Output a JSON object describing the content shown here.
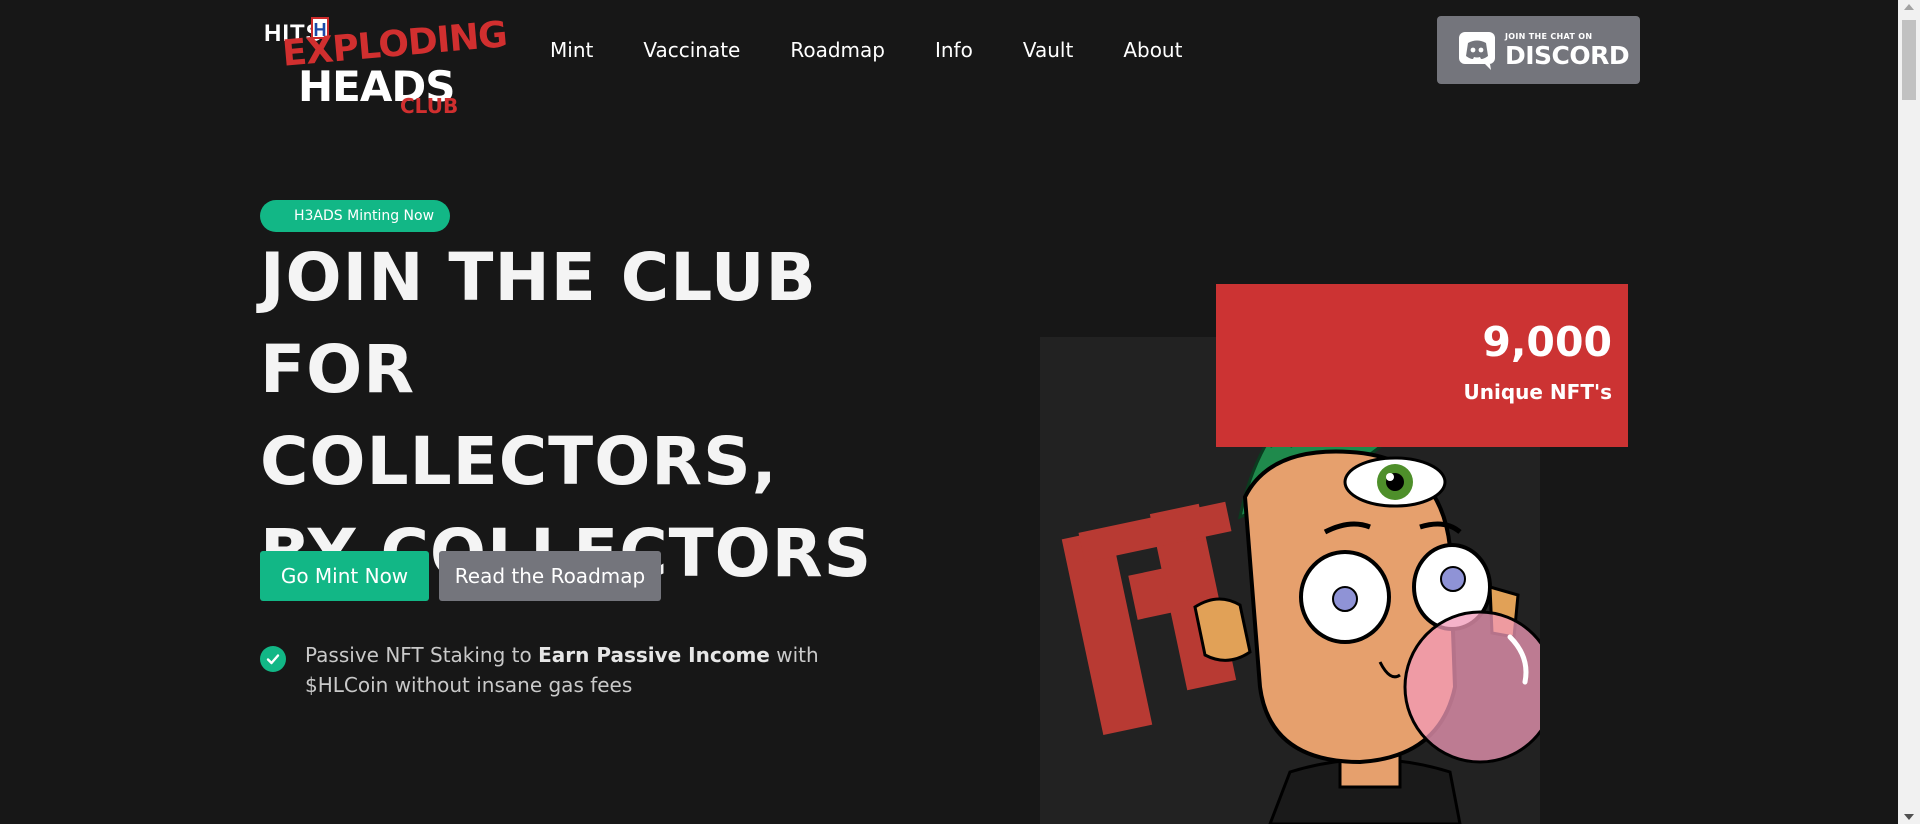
{
  "header": {
    "logo": {
      "line0": "HITS",
      "badge": "H",
      "line1": "EXPLODING",
      "line2": "HEADS",
      "line3": "CLUB"
    },
    "nav": [
      "Mint",
      "Vaccinate",
      "Roadmap",
      "Info",
      "Vault",
      "About"
    ],
    "discord": {
      "small": "JOIN THE CHAT ON",
      "big": "DISCORD"
    }
  },
  "hero": {
    "badge": "H3ADS Minting Now",
    "title_lines": [
      "JOIN THE CLUB",
      "FOR COLLECTORS,",
      "BY COLLECTORS"
    ],
    "primary_button": "Go Mint Now",
    "secondary_button": "Read the Roadmap",
    "feature": {
      "pre": "Passive NFT Staking to ",
      "bold": "Earn Passive Income",
      "post": " with $HLCoin without insane gas fees"
    }
  },
  "stats": {
    "value": "9,000",
    "label": "Unique NFT's"
  },
  "colors": {
    "accent_green": "#12b786",
    "accent_red": "#cc3333",
    "background": "#171717",
    "button_gray": "#74757c"
  }
}
